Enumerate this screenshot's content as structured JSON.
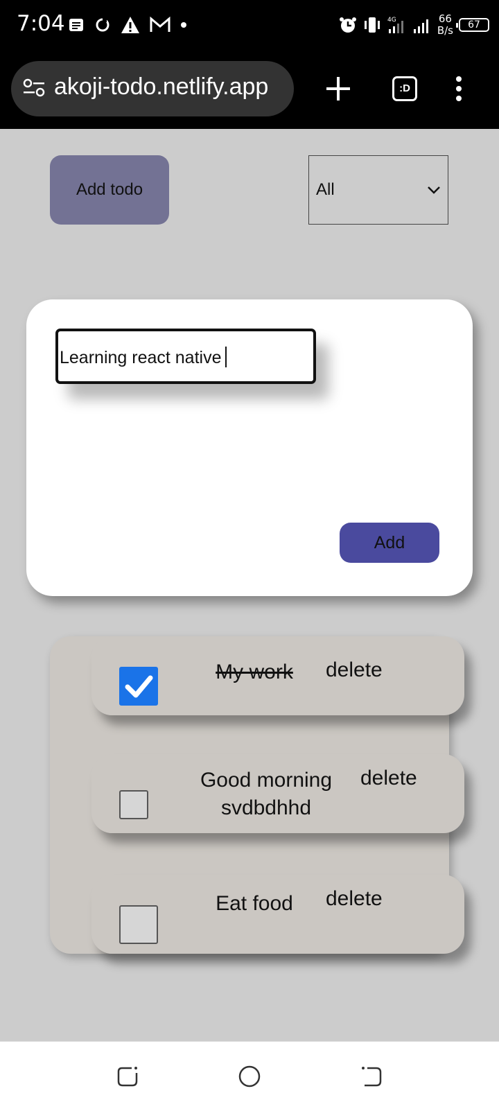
{
  "status_bar": {
    "time": "7:04",
    "network_speed_value": "66",
    "network_speed_unit": "B/s",
    "network_type": "4G",
    "battery": "67",
    "left_icons": [
      "notes-icon",
      "sync-icon",
      "warning-icon",
      "gmail-icon",
      "dot-icon"
    ],
    "right_icons": [
      "alarm-icon",
      "vibrate-icon",
      "signal-icon",
      "signal-icon"
    ]
  },
  "browser": {
    "url": "akoji-todo.netlify.app",
    "tab_switcher_label": ":D",
    "icons": [
      "site-settings-icon",
      "plus-icon",
      "more-vert-icon"
    ]
  },
  "app": {
    "add_todo_label": "Add todo",
    "filter": {
      "selected": "All"
    },
    "modal": {
      "input_value": "Learning react native",
      "add_label": "Add"
    },
    "todos": [
      {
        "lines": [
          "My work"
        ],
        "done": true,
        "delete_label": "delete"
      },
      {
        "lines": [
          "Good morning",
          "svdbdhhd"
        ],
        "done": false,
        "delete_label": "delete"
      },
      {
        "lines": [
          "Eat food"
        ],
        "done": false,
        "delete_label": "delete"
      }
    ]
  },
  "colors": {
    "background": "#cccccc",
    "add_todo_button": "#737294",
    "add_button": "#4a4a9e",
    "card": "#cbc7c2",
    "checkbox_checked": "#1a73e8"
  },
  "nav": {
    "icons": [
      "recents-icon",
      "home-icon",
      "back-icon"
    ]
  }
}
